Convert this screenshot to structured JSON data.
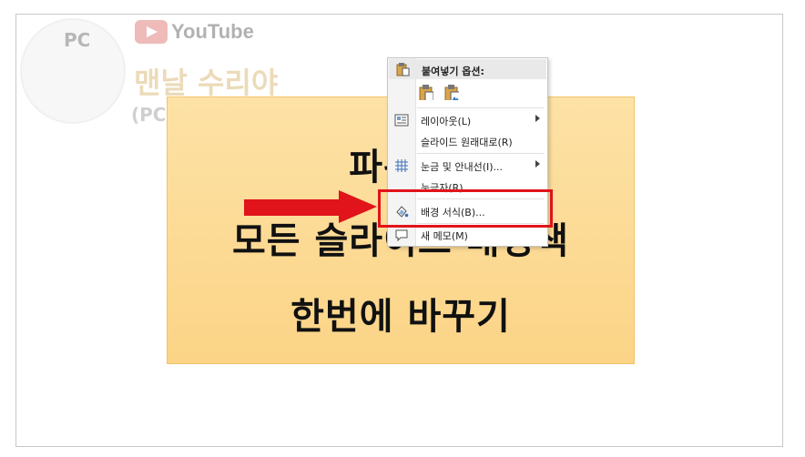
{
  "watermark": {
    "pc_badge": "PC",
    "youtube_label": "YouTube",
    "channel_title": "맨날 수리야",
    "channel_subtitle": "(PC 무료 수리, 꿀팁)"
  },
  "slide": {
    "line1": "파워포",
    "line2": "모든 슬라이드 배경색",
    "line3": "한번에 바꾸기"
  },
  "context_menu": {
    "paste_header": "붙여넣기 옵션:",
    "items": [
      {
        "label": "레이아웃(L)",
        "has_submenu": true,
        "icon": "layout-icon"
      },
      {
        "label": "슬라이드 원래대로(R)",
        "has_submenu": false,
        "icon": ""
      },
      {
        "label": "눈금 및 안내선(I)...",
        "has_submenu": true,
        "icon": "grid-icon"
      },
      {
        "label": "눈금자(R)",
        "has_submenu": false,
        "icon": ""
      },
      {
        "label": "배경 서식(B)...",
        "has_submenu": false,
        "icon": "format-background-icon"
      },
      {
        "label": "새 메모(M)",
        "has_submenu": false,
        "icon": "comment-icon"
      }
    ]
  },
  "colors": {
    "highlight": "#e0141a",
    "textbox_fill": "#fbd486",
    "arrow": "#e0141a"
  }
}
